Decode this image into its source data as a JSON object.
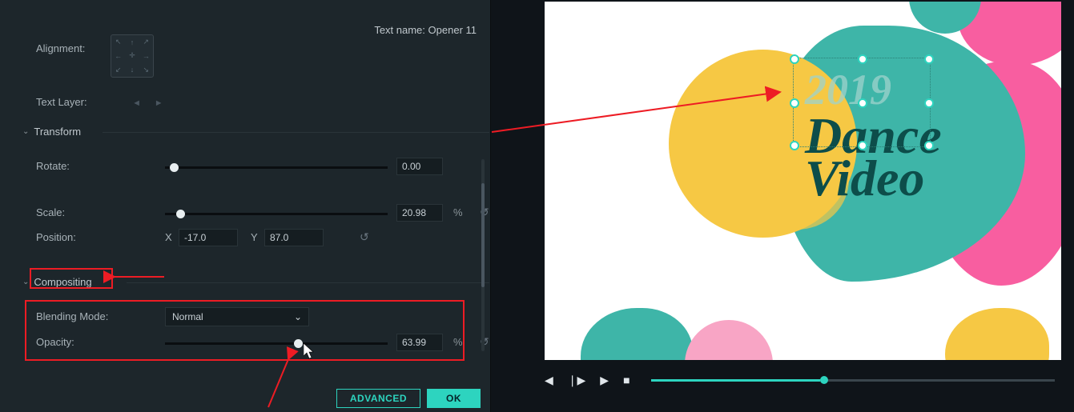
{
  "header": {
    "text_name_label": "Text name:",
    "text_name_value": "Opener 11"
  },
  "labels": {
    "alignment": "Alignment:",
    "text_layer": "Text Layer:",
    "rotate": "Rotate:",
    "scale": "Scale:",
    "position": "Position:",
    "blending_mode": "Blending Mode:",
    "opacity": "Opacity:",
    "x": "X",
    "y": "Y",
    "pct": "%"
  },
  "sections": {
    "transform": "Transform",
    "compositing": "Compositing"
  },
  "transform": {
    "rotate": {
      "value": "0.00",
      "slider_pct": 2
    },
    "scale": {
      "value": "20.98",
      "slider_pct": 5
    },
    "position": {
      "x": "-17.0",
      "y": "87.0"
    }
  },
  "compositing": {
    "blending_mode": {
      "selected": "Normal"
    },
    "opacity": {
      "value": "63.99",
      "slider_pct": 58
    }
  },
  "buttons": {
    "advanced": "ADVANCED",
    "ok": "OK"
  },
  "preview": {
    "text_line1": "2019",
    "text_line2": "Dance",
    "text_line3": "Video"
  },
  "playback": {
    "progress_pct": 42
  },
  "icons": {
    "chev_down": "⌄",
    "dropdown": "⌄",
    "reset": "↺",
    "prev_frame": "◀",
    "play_pair": "❘▶",
    "play": "▶",
    "stop": "■",
    "tri_left": "◄",
    "tri_right": "►",
    "align_nw": "↖",
    "align_n": "↑",
    "align_ne": "↗",
    "align_w": "←",
    "align_c": "✛",
    "align_e": "→",
    "align_sw": "↙",
    "align_s": "↓",
    "align_se": "↘"
  }
}
